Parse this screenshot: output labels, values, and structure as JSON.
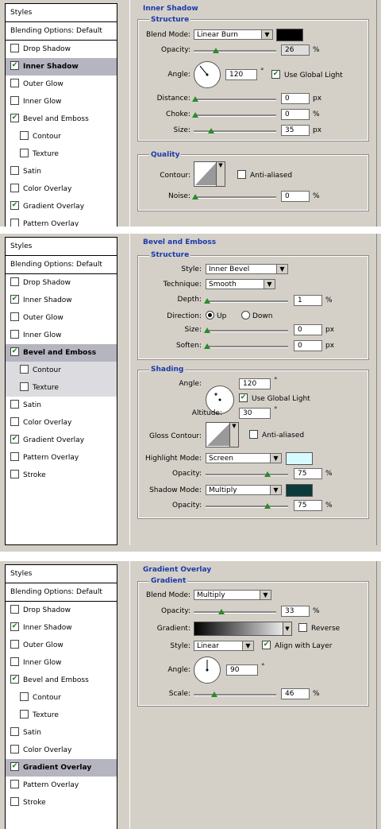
{
  "sidebar": {
    "title": "Styles",
    "blending": "Blending Options: Default",
    "items": [
      "Drop Shadow",
      "Inner Shadow",
      "Outer Glow",
      "Inner Glow",
      "Bevel and Emboss",
      "Contour",
      "Texture",
      "Satin",
      "Color Overlay",
      "Gradient Overlay",
      "Pattern Overlay",
      "Stroke"
    ],
    "check": "✔"
  },
  "panel1": {
    "title": "Inner Shadow",
    "structure": "Structure",
    "blend_label": "Blend Mode:",
    "blend_value": "Linear Burn",
    "opacity_label": "Opacity:",
    "opacity_value": "26",
    "opacity_level": 0.26,
    "angle_label": "Angle:",
    "angle_value": "120",
    "deg": "°",
    "global_light": "Use Global Light",
    "distance_label": "Distance:",
    "distance_value": "0",
    "px": "px",
    "choke_label": "Choke:",
    "choke_value": "0",
    "pct": "%",
    "size_label": "Size:",
    "size_value": "35",
    "quality": "Quality",
    "contour_label": "Contour:",
    "anti_aliased": "Anti-aliased",
    "noise_label": "Noise:",
    "noise_value": "0",
    "color": "#000000"
  },
  "panel2": {
    "title": "Bevel and Emboss",
    "structure": "Structure",
    "style_label": "Style:",
    "style_value": "Inner Bevel",
    "technique_label": "Technique:",
    "technique_value": "Smooth",
    "depth_label": "Depth:",
    "depth_value": "1",
    "direction_label": "Direction:",
    "up": "Up",
    "down": "Down",
    "size_label": "Size:",
    "size_value": "0",
    "soften_label": "Soften:",
    "soften_value": "0",
    "shading": "Shading",
    "angle_label": "Angle:",
    "angle_value": "120",
    "global_light": "Use Global Light",
    "altitude_label": "Altitude:",
    "altitude_value": "30",
    "gloss_label": "Gloss Contour:",
    "anti_aliased": "Anti-aliased",
    "highlight_label": "Highlight Mode:",
    "highlight_value": "Screen",
    "highlight_color": "#d8fbff",
    "h_opacity_label": "Opacity:",
    "h_opacity_value": "75",
    "shadow_label": "Shadow Mode:",
    "shadow_value": "Multiply",
    "shadow_color": "#0e3a3a",
    "s_opacity_label": "Opacity:",
    "s_opacity_value": "75",
    "px": "px",
    "pct": "%",
    "deg": "°"
  },
  "panel3": {
    "title": "Gradient Overlay",
    "gradient": "Gradient",
    "blend_label": "Blend Mode:",
    "blend_value": "Multiply",
    "opacity_label": "Opacity:",
    "opacity_value": "33",
    "gradient_label": "Gradient:",
    "reverse": "Reverse",
    "style_label": "Style:",
    "style_value": "Linear",
    "align": "Align with Layer",
    "angle_label": "Angle:",
    "angle_value": "90",
    "scale_label": "Scale:",
    "scale_value": "46",
    "pct": "%",
    "deg": "°"
  }
}
